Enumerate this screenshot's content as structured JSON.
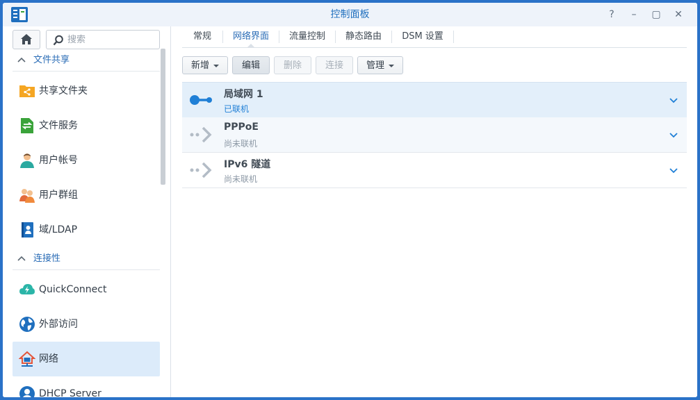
{
  "window": {
    "title": "控制面板",
    "controls": [
      "?",
      "–",
      "▢",
      "✕"
    ]
  },
  "sidebar": {
    "search_placeholder": "搜索",
    "sections": [
      {
        "title": "文件共享",
        "items": [
          {
            "label": "共享文件夹",
            "icon": "shared-folder-icon",
            "color": "#f5a623"
          },
          {
            "label": "文件服务",
            "icon": "file-services-icon",
            "color": "#3aa33a"
          },
          {
            "label": "用户帐号",
            "icon": "user-icon",
            "color": "#2aa9a0"
          },
          {
            "label": "用户群组",
            "icon": "group-icon",
            "color": "#e36b3a"
          },
          {
            "label": "域/LDAP",
            "icon": "domain-ldap-icon",
            "color": "#1f6fbe"
          }
        ]
      },
      {
        "title": "连接性",
        "items": [
          {
            "label": "QuickConnect",
            "icon": "quickconnect-icon",
            "color": "#2bb5a8"
          },
          {
            "label": "外部访问",
            "icon": "external-access-icon",
            "color": "#1f6fbe"
          },
          {
            "label": "网络",
            "icon": "network-icon",
            "color": "#e3553a",
            "selected": true
          },
          {
            "label": "DHCP Server",
            "icon": "dhcp-server-icon",
            "color": "#1f6fbe"
          }
        ]
      }
    ]
  },
  "main": {
    "tabs": [
      {
        "label": "常规"
      },
      {
        "label": "网络界面",
        "active": true
      },
      {
        "label": "流量控制"
      },
      {
        "label": "静态路由"
      },
      {
        "label": "DSM 设置"
      }
    ],
    "toolbar": {
      "add": "新增",
      "edit": "编辑",
      "delete": "删除",
      "connect": "连接",
      "manage": "管理"
    },
    "interfaces": [
      {
        "name": "局域网 1",
        "status": "已联机",
        "connected": true
      },
      {
        "name": "PPPoE",
        "status": "尚未联机",
        "connected": false
      },
      {
        "name": "IPv6 隧道",
        "status": "尚未联机",
        "connected": false
      }
    ]
  },
  "colors": {
    "accent": "#2a6cb6",
    "connected": "#1f7fd6",
    "disconnected": "#8d99a6",
    "selected_bg": "#dcebfa"
  }
}
